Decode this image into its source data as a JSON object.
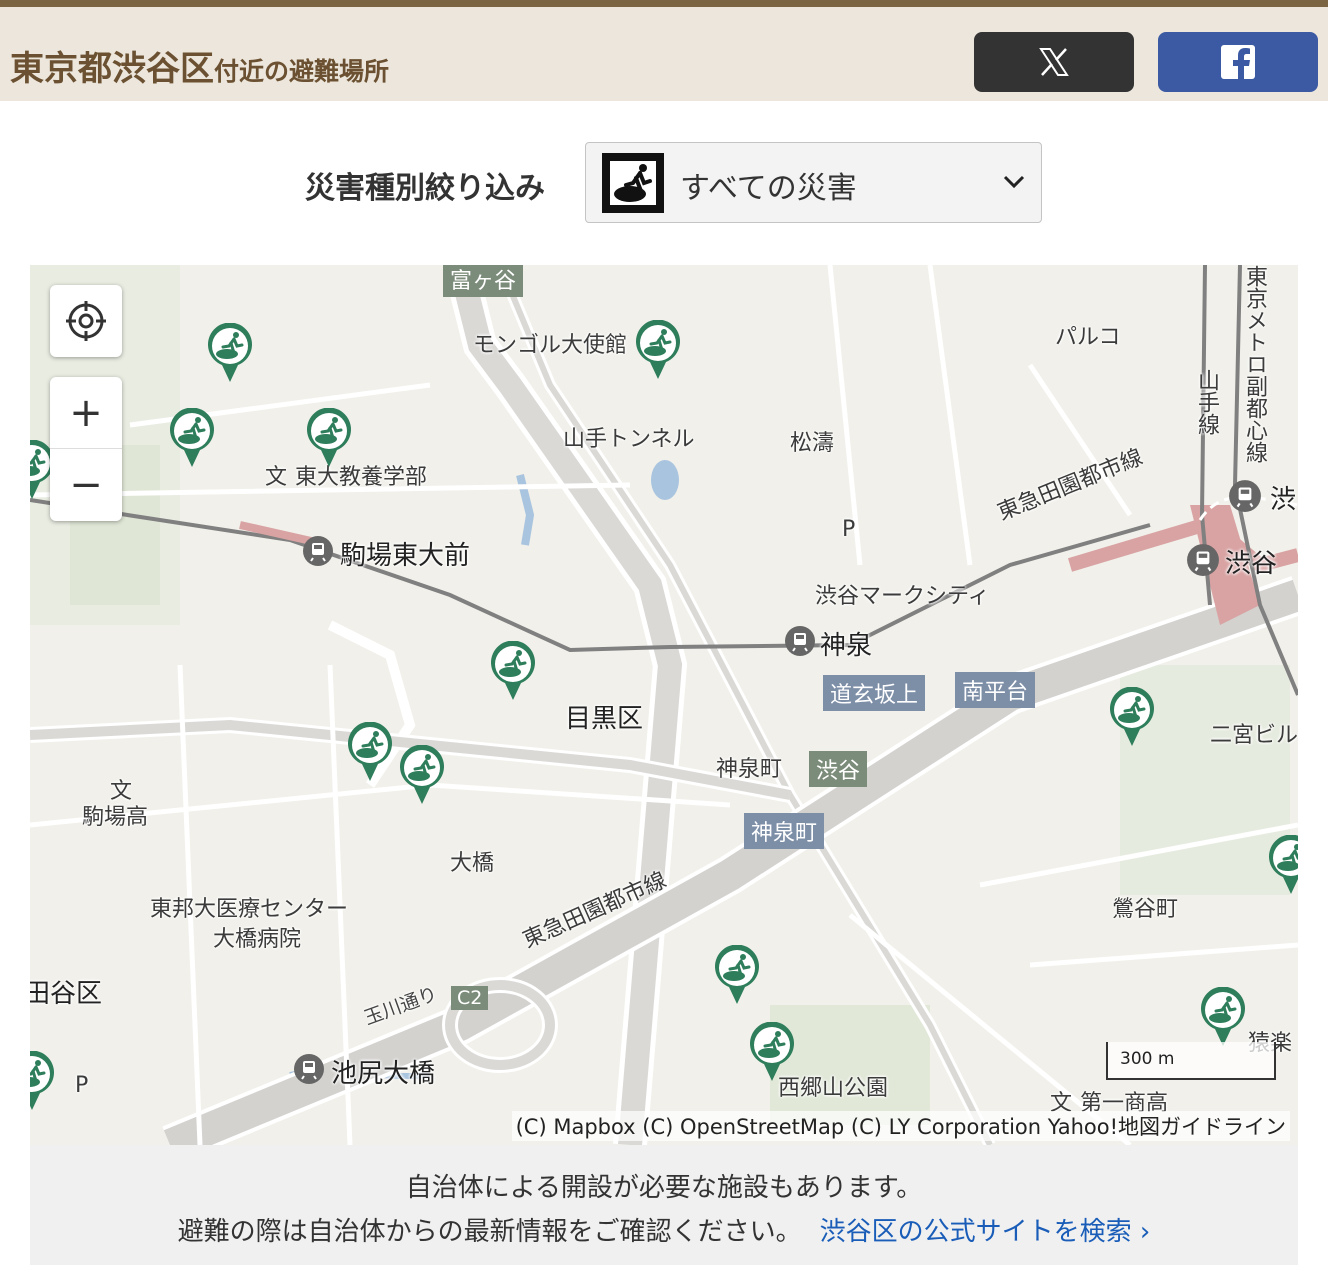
{
  "header": {
    "title_area": "東京都渋谷区",
    "title_suffix": "付近の避難場所",
    "x_share_icon": "x-logo-icon",
    "facebook_share_icon": "facebook-logo-icon"
  },
  "filter": {
    "label": "災害種別絞り込み",
    "selected_icon": "evacuation-runner-icon",
    "selected": "すべての災害"
  },
  "map": {
    "controls": {
      "locate_icon": "crosshair-icon",
      "zoom_in": "+",
      "zoom_out": "−"
    },
    "places": {
      "tomigaya": "富ヶ谷",
      "mongol": "モンゴル大使館",
      "parco": "パルコ",
      "tokyo_metro": "東京メトロ副都心線",
      "yamanote": "山手線",
      "yamate_tunnel": "山手トンネル",
      "shoto": "松濤",
      "todai_kyoyo": "東大教養学部",
      "komaba_todaimae": "駒場東大前",
      "toyoko_line_top": "東急田園都市線",
      "shibuya_left": "渋",
      "shibuya": "渋谷",
      "p1": "P",
      "p2": "P",
      "shibuya_mark_city": "渋谷マークシティ",
      "shinsen": "神泉",
      "dogenzaka_ue": "道玄坂上",
      "minami_heidai": "南平台",
      "meguro_ku": "目黒区",
      "ninomiya_bldg": "二宮ビル",
      "shinsen_cho": "神泉町",
      "shibuya_badge": "渋谷",
      "shinsen_cho_badge": "神泉町",
      "komaba_ko": "駒場高",
      "ohashi": "大橋",
      "uguisudani": "鶯谷町",
      "toho_hospital_1": "東邦大医療センター",
      "toho_hospital_2": "大橋病院",
      "toyoko_line_bottom": "東急田園都市線",
      "setagaya": "田谷区",
      "tamagawa_dori": "玉川通り",
      "c2": "C2",
      "ikejiri_ohashi": "池尻大橋",
      "saigoyama": "西郷山公園",
      "daiichi_shoko": "第一商高",
      "sarugaku": "猿楽",
      "school_mark": "文",
      "school_mark_2": "文",
      "school_mark_3": "文"
    },
    "scale": "300 m",
    "attribution": "(C) Mapbox (C) OpenStreetMap (C) LY Corporation Yahoo!地図ガイドライン",
    "colors": {
      "pin": "#2e7d5b",
      "railway": "#808080",
      "station": "#d9a3a3",
      "expressway": "#dad9d6"
    }
  },
  "notice": {
    "line1": "自治体による開設が必要な施設もあります。",
    "line2": "避難の際は自治体からの最新情報をご確認ください。",
    "link": "渋谷区の公式サイトを検索"
  }
}
